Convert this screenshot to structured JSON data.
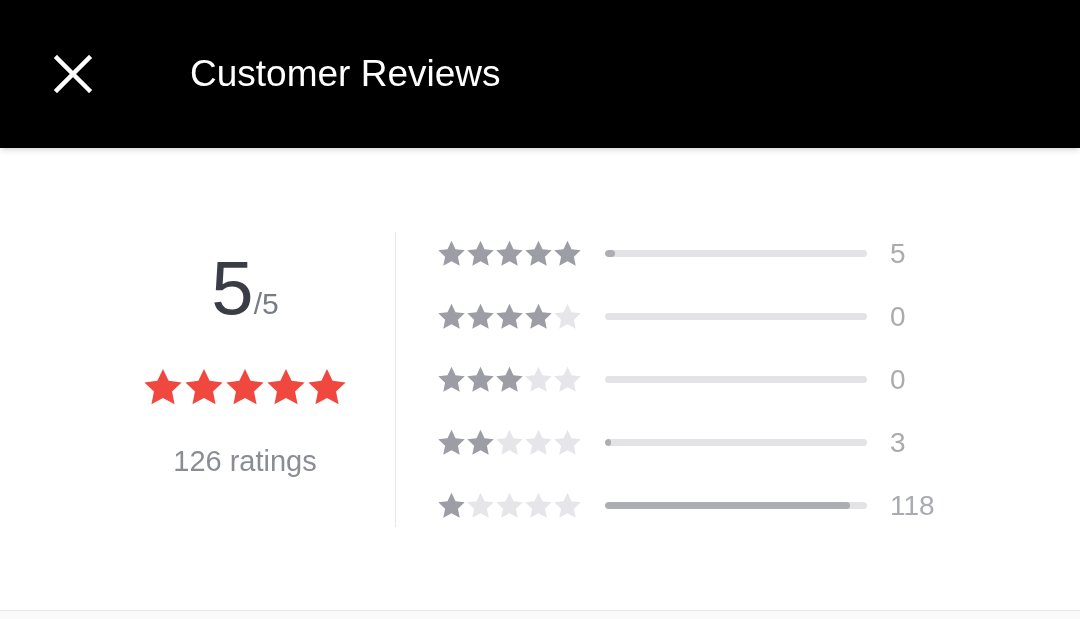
{
  "header": {
    "title": "Customer Reviews"
  },
  "summary": {
    "score": "5",
    "out_of": "/5",
    "stars": 5,
    "ratings": "126 ratings"
  },
  "breakdown": [
    {
      "stars": 5,
      "level": 0.04,
      "count": "5"
    },
    {
      "stars": 4,
      "level": 0,
      "count": "0"
    },
    {
      "stars": 3,
      "level": 0,
      "count": "0"
    },
    {
      "stars": 2,
      "level": 0.024,
      "count": "3"
    },
    {
      "stars": 1,
      "level": 0.937,
      "count": "118"
    }
  ]
}
